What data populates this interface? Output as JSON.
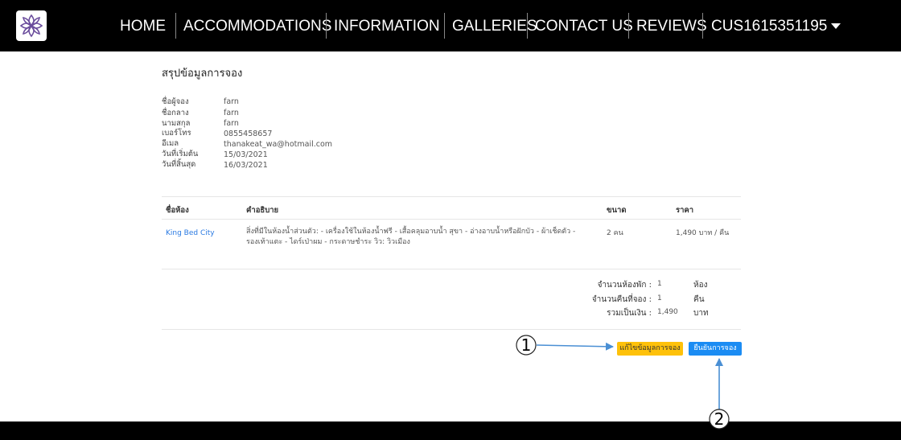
{
  "nav": {
    "items": [
      "HOME",
      "ACCOMMODATIONS",
      "INFORMATION",
      "GALLERIES",
      "CONTACT US",
      "REVIEWS"
    ],
    "user": "CUS1615351195",
    "logo_icon": "lotus-logo-icon"
  },
  "summary": {
    "title": "สรุปข้อมูลการจอง",
    "fields": [
      {
        "label": "ชื่อผู้จอง",
        "value": "farn"
      },
      {
        "label": "ชื่อกลาง",
        "value": "farn"
      },
      {
        "label": "นามสกุล",
        "value": "farn"
      },
      {
        "label": "เบอร์โทร",
        "value": "0855458657"
      },
      {
        "label": "อีเมล",
        "value": "thanakeat_wa@hotmail.com"
      },
      {
        "label": "วันที่เริ่มต้น",
        "value": "15/03/2021"
      },
      {
        "label": "วันที่สิ้นสุด",
        "value": "16/03/2021"
      }
    ]
  },
  "table": {
    "headers": [
      "ชื่อห้อง",
      "คำอธิบาย",
      "ขนาด",
      "ราคา"
    ],
    "rows": [
      {
        "room": "King Bed City",
        "description_line1": "สิ่งที่มีในห้องน้ำส่วนตัว: - เครื่องใช้ในห้องน้ำฟรี - เสื้อคลุมอาบน้ำ สุขา - อ่างอาบน้ำหรือฝักบัว - ผ้าเช็ดตัว -",
        "description_line2": "รองเท้าแตะ - ไดร์เป่าผม - กระดาษชำระ วิว: วิวเมือง",
        "size": "2 คน",
        "price": "1,490 บาท / คืน"
      }
    ]
  },
  "totals": [
    {
      "label": "จำนวนห้องพัก :",
      "value": "1",
      "unit": "ห้อง"
    },
    {
      "label": "จำนวนคืนที่จอง :",
      "value": "1",
      "unit": "คืน"
    },
    {
      "label": "รวมเป็นเงิน :",
      "value": "1,490",
      "unit": "บาท"
    }
  ],
  "buttons": {
    "edit": "แก้ไขข้อมูลการจอง",
    "confirm": "ยืนยันการจอง"
  },
  "callouts": [
    "1",
    "2"
  ],
  "colors": {
    "edit_button": "#fec10a",
    "confirm_button": "#1b8cf3",
    "link": "#2a7ae2",
    "annotation_arrow": "#4a8fd4"
  }
}
